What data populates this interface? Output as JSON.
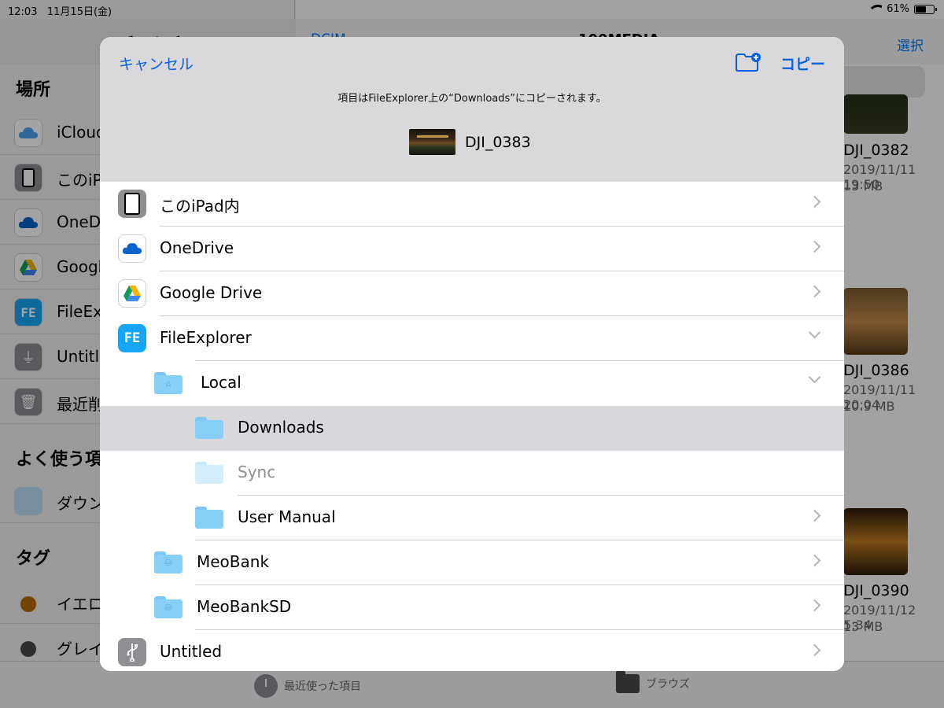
{
  "status_bar": {
    "time": "12:03",
    "date": "11月15日(金)",
    "battery": "61%",
    "battery_level": 0.61
  },
  "background": {
    "sidebar_title": "ブラウズ",
    "back_label": "DCIM",
    "folder_title": "100MEDIA",
    "select_label": "選択",
    "locations_header": "場所",
    "locations": [
      {
        "label": "iCloud Drive",
        "icon": "icloud-icon"
      },
      {
        "label": "このiPad内",
        "icon": "ipad-icon"
      },
      {
        "label": "OneDrive",
        "icon": "onedrive-icon"
      },
      {
        "label": "Google Drive",
        "icon": "google-drive-icon"
      },
      {
        "label": "FileExplorer",
        "icon": "fileexplorer-icon"
      },
      {
        "label": "Untitled",
        "icon": "usb-icon"
      },
      {
        "label": "最近削除した項目",
        "icon": "trash-icon"
      }
    ],
    "favorites_header": "よく使う項目",
    "favorites": [
      {
        "label": "ダウンロード",
        "icon": "downloads-folder-icon"
      }
    ],
    "tags_header": "タグ",
    "tags": [
      {
        "label": "イエロー",
        "color": "#b8680a"
      },
      {
        "label": "グレイ",
        "color": "#4a4a4c"
      }
    ],
    "files": [
      {
        "name": "DJI_0382",
        "date": "2019/11/11 19:50",
        "size": "13 MB"
      },
      {
        "name": "DJI_0386",
        "date": "2019/11/11 20:04",
        "size": "10.9 MB"
      },
      {
        "name": "DJI_0390",
        "date": "2019/11/12 5:34",
        "size": "13 MB"
      }
    ],
    "tabs": {
      "recents": "最近使った項目",
      "browse": "ブラウズ"
    }
  },
  "modal": {
    "cancel_label": "キャンセル",
    "copy_label": "コピー",
    "message": "項目はFileExplorer上の“Downloads”にコピーされます。",
    "file_name": "DJI_0383",
    "rows": [
      {
        "label": "このiPad内",
        "icon": "ipad-icon",
        "chevron": "right"
      },
      {
        "label": "OneDrive",
        "icon": "onedrive-icon",
        "chevron": "right"
      },
      {
        "label": "Google Drive",
        "icon": "google-drive-icon",
        "chevron": "right"
      },
      {
        "label": "FileExplorer",
        "icon": "fileexplorer-icon",
        "icon_text": "FE",
        "chevron": "down"
      },
      {
        "label": "Local",
        "icon": "local-folder-icon",
        "chevron": "down"
      },
      {
        "label": "Downloads",
        "icon": "folder-icon",
        "selected": true
      },
      {
        "label": "Sync",
        "icon": "folder-icon",
        "disabled": true
      },
      {
        "label": "User Manual",
        "icon": "folder-icon",
        "chevron": "right"
      },
      {
        "label": "MeoBank",
        "icon": "shared-folder-icon",
        "chevron": "right"
      },
      {
        "label": "MeoBankSD",
        "icon": "shared-folder-icon",
        "chevron": "right"
      },
      {
        "label": "Untitled",
        "icon": "usb-icon",
        "chevron": "right"
      }
    ]
  }
}
